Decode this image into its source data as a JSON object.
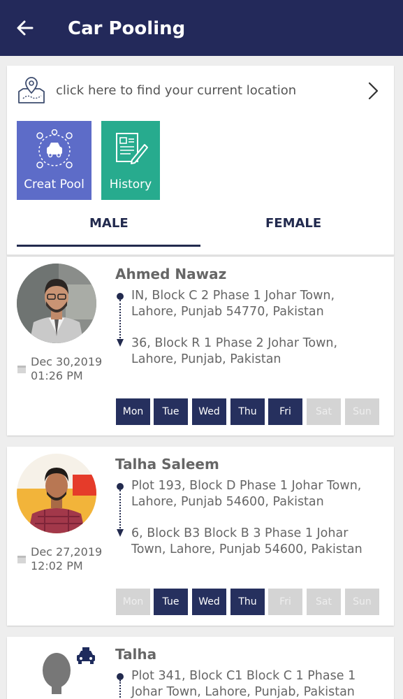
{
  "appbar": {
    "title": "Car Pooling"
  },
  "location": {
    "prompt": "click here to find your current location"
  },
  "tiles": [
    {
      "label": "Creat Pool",
      "color": "#5d6cc8"
    },
    {
      "label": "History",
      "color": "#27ab8e"
    }
  ],
  "tabs": [
    {
      "label": "MALE",
      "active": true
    },
    {
      "label": "FEMALE",
      "active": false
    }
  ],
  "rides": [
    {
      "name": "Ahmed Nawaz",
      "from": "IN, Block C 2 Phase 1 Johar Town, Lahore, Punjab 54770, Pakistan",
      "to": "36, Block R 1 Phase 2 Johar Town, Lahore, Punjab, Pakistan",
      "date": "Dec 30,2019",
      "time": "01:26 PM",
      "days": [
        {
          "label": "Mon",
          "active": true
        },
        {
          "label": "Tue",
          "active": true
        },
        {
          "label": "Wed",
          "active": true
        },
        {
          "label": "Thu",
          "active": true
        },
        {
          "label": "Fri",
          "active": true
        },
        {
          "label": "Sat",
          "active": false
        },
        {
          "label": "Sun",
          "active": false
        }
      ]
    },
    {
      "name": "Talha Saleem",
      "from": "Plot 193, Block D Phase 1 Johar Town, Lahore, Punjab 54600, Pakistan",
      "to": "6, Block B3 Block B 3 Phase 1 Johar Town, Lahore, Punjab 54600, Pakistan",
      "date": "Dec 27,2019",
      "time": "12:02 PM",
      "days": [
        {
          "label": "Mon",
          "active": false
        },
        {
          "label": "Tue",
          "active": true
        },
        {
          "label": "Wed",
          "active": true
        },
        {
          "label": "Thu",
          "active": true
        },
        {
          "label": "Fri",
          "active": false
        },
        {
          "label": "Sat",
          "active": false
        },
        {
          "label": "Sun",
          "active": false
        }
      ]
    },
    {
      "name": "Talha",
      "from": "Plot 341, Block C1 Block C 1 Phase 1 Johar Town, Lahore, Punjab, Pakistan"
    }
  ],
  "colors": {
    "primary": "#23295a",
    "day_active": "#26305e",
    "day_inactive": "#d4d4d4"
  }
}
